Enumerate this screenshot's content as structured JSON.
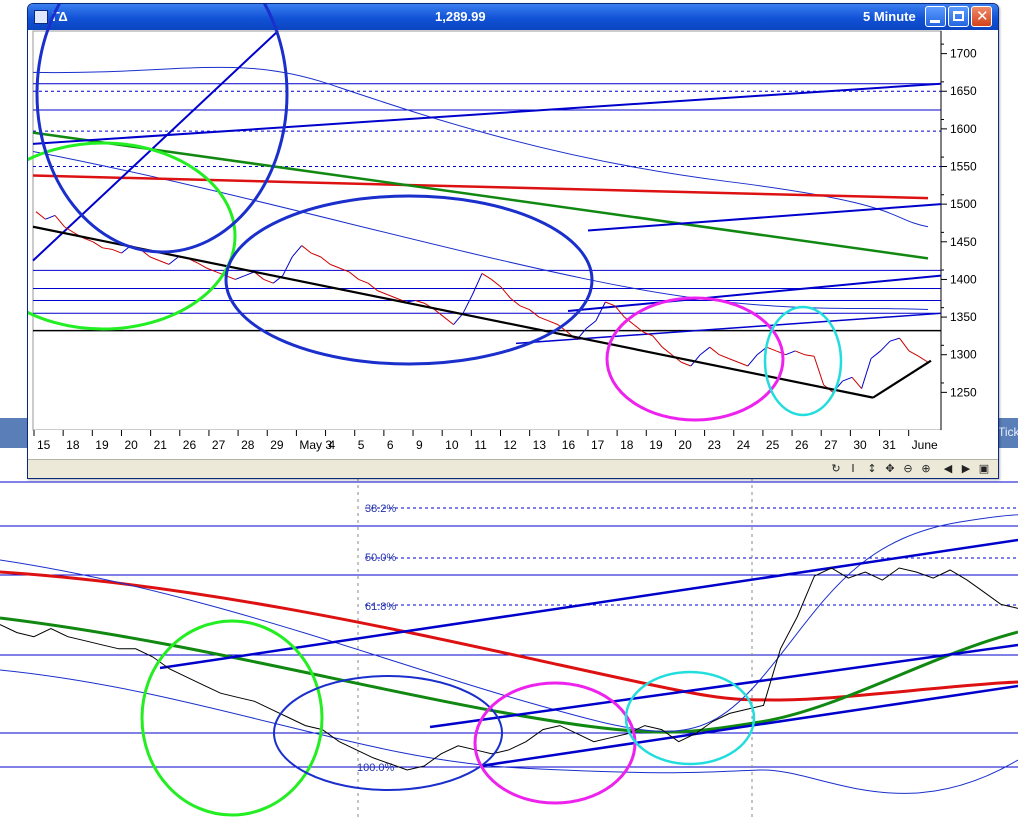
{
  "window": {
    "symbol": "ΓΔ",
    "price": "1,289.99",
    "interval": "5 Minute"
  },
  "background_window": {
    "tab_fragment": "Tick"
  },
  "toolbar": {
    "icons": [
      "refresh-icon",
      "text-cursor-icon",
      "scroll-vertical-icon",
      "pan-icon",
      "zoom-out-icon",
      "zoom-in-icon",
      "scroll-left-icon",
      "scroll-right-icon",
      "maximize-icon"
    ]
  },
  "colors": {
    "price_up": "#0000cc",
    "price_down": "#cc0000",
    "trendline_blue": "#0000cc",
    "circle_green": "#22ee22",
    "circle_blue": "#1a2fcc",
    "circle_magenta": "#ee22ee",
    "circle_cyan": "#22dddd",
    "ma_red": "#dd1111",
    "ma_green": "#118811"
  },
  "chart_data": [
    {
      "type": "line",
      "title": "ΓΔ 5 Minute",
      "ylim": [
        1200,
        1730
      ],
      "y_ticks": [
        1250,
        1300,
        1350,
        1400,
        1450,
        1500,
        1550,
        1600,
        1650,
        1700
      ],
      "x_tick_labels": [
        "15",
        "18",
        "19",
        "20",
        "21",
        "26",
        "27",
        "28",
        "29",
        "May 3",
        "4",
        "5",
        "6",
        "9",
        "10",
        "11",
        "12",
        "13",
        "16",
        "17",
        "18",
        "19",
        "20",
        "23",
        "24",
        "25",
        "26",
        "27",
        "30",
        "31",
        "June"
      ],
      "series": [
        {
          "values": [
            1490,
            1480,
            1485,
            1470,
            1462,
            1455,
            1450,
            1442,
            1440,
            1435,
            1445,
            1440,
            1430,
            1425,
            1420,
            1430,
            1428,
            1422,
            1415,
            1410,
            1405,
            1400,
            1405,
            1410,
            1400,
            1395,
            1405,
            1430,
            1445,
            1435,
            1430,
            1420,
            1415,
            1410,
            1400,
            1395,
            1385,
            1380,
            1375,
            1370,
            1372,
            1368,
            1360,
            1350,
            1340,
            1355,
            1380,
            1408,
            1400,
            1390,
            1375,
            1365,
            1360,
            1350,
            1345,
            1340,
            1330,
            1320,
            1335,
            1345,
            1370,
            1365,
            1350,
            1340,
            1330,
            1325,
            1310,
            1300,
            1290,
            1285,
            1300,
            1310,
            1300,
            1295,
            1290,
            1285,
            1300,
            1310,
            1305,
            1300,
            1305,
            1300,
            1298,
            1260,
            1250,
            1265,
            1270,
            1255,
            1295,
            1305,
            1318,
            1322,
            1305,
            1298,
            1290
          ]
        }
      ],
      "lines": [
        {
          "kind": "horizontal",
          "y": 1660,
          "color": "blue"
        },
        {
          "kind": "horizontal",
          "y": 1650,
          "color": "blue",
          "dashed": true
        },
        {
          "kind": "horizontal",
          "y": 1625,
          "color": "blue"
        },
        {
          "kind": "horizontal",
          "y": 1597,
          "color": "blue",
          "dashed": true
        },
        {
          "kind": "horizontal",
          "y": 1550,
          "color": "blue",
          "dashed": true
        },
        {
          "kind": "horizontal",
          "y": 1412,
          "color": "blue"
        },
        {
          "kind": "horizontal",
          "y": 1388,
          "color": "blue"
        },
        {
          "kind": "horizontal",
          "y": 1372,
          "color": "blue"
        },
        {
          "kind": "horizontal",
          "y": 1355,
          "color": "blue"
        },
        {
          "kind": "horizontal",
          "y": 1332,
          "color": "black"
        }
      ]
    },
    {
      "type": "line",
      "annotations": [
        "38.2%",
        "50.0%",
        "61.8%",
        "100.0%"
      ],
      "series": [
        {
          "values": [
            0.72,
            0.68,
            0.66,
            0.7,
            0.66,
            0.64,
            0.62,
            0.6,
            0.6,
            0.56,
            0.5,
            0.46,
            0.42,
            0.38,
            0.36,
            0.34,
            0.3,
            0.26,
            0.22,
            0.2,
            0.14,
            0.1,
            0.06,
            0.03,
            0.0,
            0.02,
            0.08,
            0.12,
            0.1,
            0.08,
            0.1,
            0.14,
            0.2,
            0.22,
            0.18,
            0.14,
            0.16,
            0.18,
            0.22,
            0.2,
            0.14,
            0.18,
            0.24,
            0.28,
            0.3,
            0.32,
            0.6,
            0.76,
            0.96,
            1.0,
            0.95,
            0.98,
            0.94,
            1.0,
            0.98,
            0.95,
            0.99,
            0.94,
            0.88,
            0.82,
            0.8
          ]
        }
      ]
    }
  ]
}
